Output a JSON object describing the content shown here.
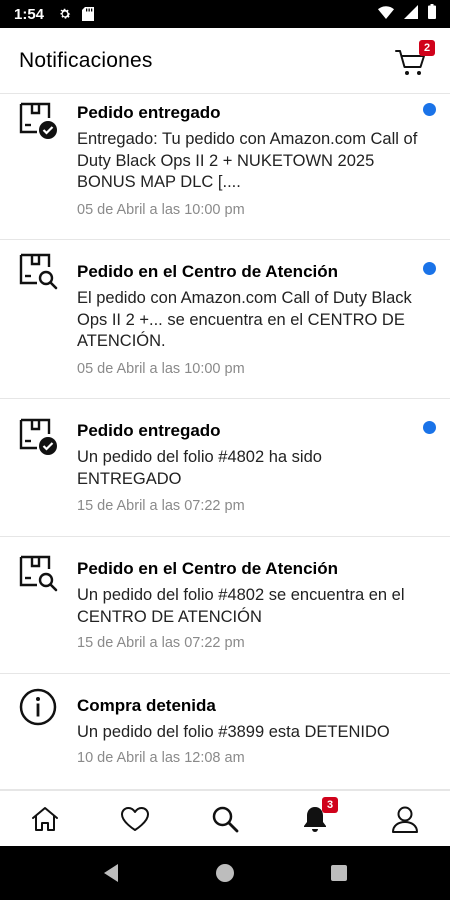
{
  "status_bar": {
    "time": "1:54"
  },
  "header": {
    "title": "Notificaciones",
    "cart_count": "2"
  },
  "notifications": [
    {
      "title": "Pedido entregado",
      "body": "Entregado: Tu pedido con Amazon.com Call of Duty Black Ops II 2 + NUKETOWN 2025 BONUS MAP DLC [....",
      "time": "05 de Abril a las 10:00 pm",
      "icon": "package-check-icon",
      "unread": true
    },
    {
      "title": "Pedido en el Centro de Atención",
      "body": "El pedido con Amazon.com Call of Duty Black Ops II 2 +... se encuentra en el CENTRO DE ATENCIÓN.",
      "time": "05 de Abril a las 10:00 pm",
      "icon": "package-search-icon",
      "unread": true
    },
    {
      "title": "Pedido entregado",
      "body": "Un pedido del folio #4802 ha sido ENTREGADO",
      "time": "15 de Abril a las 07:22 pm",
      "icon": "package-check-icon",
      "unread": true
    },
    {
      "title": "Pedido en el Centro de Atención",
      "body": "Un pedido del folio #4802 se encuentra en el CENTRO DE ATENCIÓN",
      "time": "15 de Abril a las 07:22 pm",
      "icon": "package-search-icon",
      "unread": false
    },
    {
      "title": "Compra detenida",
      "body": "Un pedido del folio #3899 esta DETENIDO",
      "time": "10 de Abril a las 12:08 am",
      "icon": "info-icon",
      "unread": false
    }
  ],
  "bottom_nav": {
    "notifications_count": "3"
  },
  "colors": {
    "badge": "#d0021b",
    "unread_dot": "#1a73e8",
    "timestamp": "#8a8a8a"
  }
}
